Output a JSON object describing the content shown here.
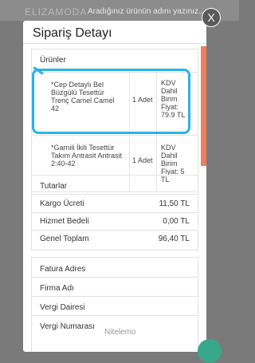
{
  "app": {
    "brand": "ELIZAMODA",
    "search_placeholder": "Aradığınız ürünün adını yazınız..."
  },
  "modal": {
    "title": "Sipariş Detayı"
  },
  "products": {
    "header": "Ürünler",
    "rows": [
      {
        "name": "*Cep Detaylı Bel Büzgülü Tesettür Trenç Camel Camel 42",
        "qty": "1 Adet",
        "price": "KDV Dahil Birim Fiyat: 79.9 TL"
      },
      {
        "name": "*Garnili İkili Tesettür Takım Antrasit Antrasit 2:40-42",
        "qty": "1 Adet",
        "price": "KDV Dahil Birim Fiyat: 5 TL"
      }
    ]
  },
  "totals": {
    "header": "Tutarlar",
    "rows": [
      {
        "label": "Kargo Ücreti",
        "value": "11,50 TL"
      },
      {
        "label": "Hizmet Bedeli",
        "value": "0,00 TL"
      },
      {
        "label": "Genel Toplam",
        "value": "96,40 TL"
      }
    ]
  },
  "billing": {
    "rows": [
      "Fatura Adres",
      "Firma Adı",
      "Vergi Dairesi",
      "Vergi Numarası"
    ]
  },
  "watermark": "Nitelemo",
  "colors": {
    "accent": "#f07d5a",
    "highlight": "#2ab3e6",
    "fab": "#39a88a"
  },
  "icons": {
    "close": "close-icon"
  }
}
